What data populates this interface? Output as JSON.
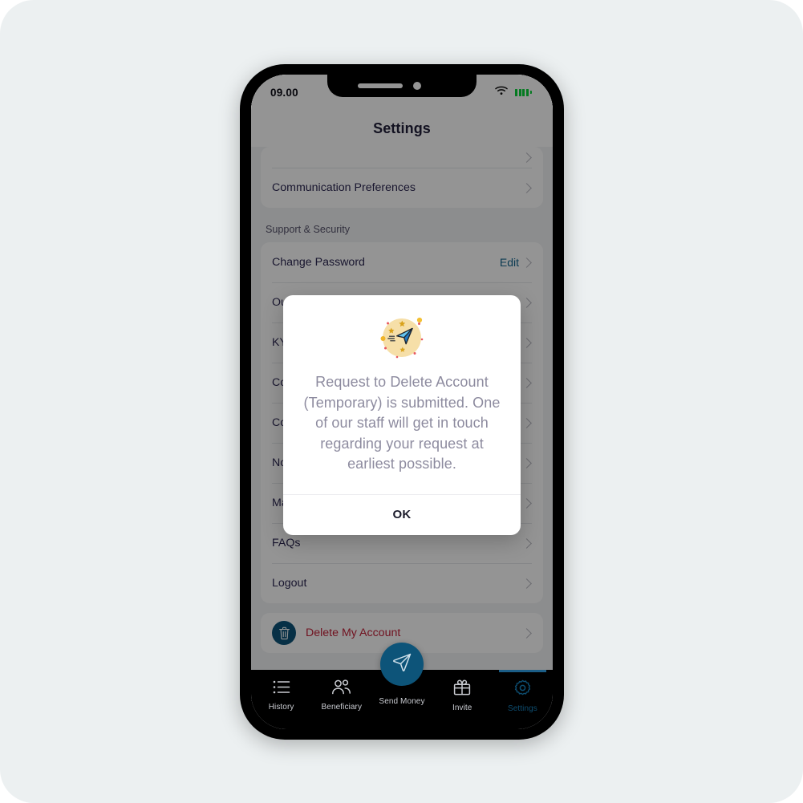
{
  "status_bar": {
    "time": "09.00",
    "wifi_icon": "wifi-icon",
    "battery_icon": "battery-icon"
  },
  "header": {
    "title": "Settings"
  },
  "settings": {
    "top_card_rows": [
      {
        "label": "Communication Preferences",
        "chevron": "chevron-right-icon"
      }
    ],
    "section_title": "Support & Security",
    "support_rows": [
      {
        "label": "Change Password",
        "action": "Edit",
        "chevron": "chevron-right-icon"
      },
      {
        "label": "Our",
        "chevron": "chevron-right-icon"
      },
      {
        "label": "KYC",
        "chevron": "chevron-right-icon"
      },
      {
        "label": "Con",
        "chevron": "chevron-right-icon"
      },
      {
        "label": "Con",
        "chevron": "chevron-right-icon"
      },
      {
        "label": "Not",
        "chevron": "chevron-right-icon"
      },
      {
        "label": "Mar",
        "chevron": "chevron-right-icon"
      },
      {
        "label": "FAQs",
        "chevron": "chevron-right-icon"
      },
      {
        "label": "Logout",
        "chevron": "chevron-right-icon"
      }
    ],
    "delete_row": {
      "label": "Delete My Account",
      "icon": "trash-icon",
      "chevron": "chevron-right-icon",
      "color": "#c32139",
      "icon_bg": "#0d5479"
    }
  },
  "modal": {
    "illustration": "paper-plane-illustration",
    "message": "Request to Delete Account (Temporary) is submitted. One of our staff will get in touch regarding your request at earliest possible.",
    "ok_label": "OK"
  },
  "bottom_nav": {
    "items": [
      {
        "label": "History",
        "icon": "list-icon",
        "active": false
      },
      {
        "label": "Beneficiary",
        "icon": "people-icon",
        "active": false
      },
      {
        "label": "Send Money",
        "icon": "send-plane-icon",
        "active": false
      },
      {
        "label": "Invite",
        "icon": "gift-icon",
        "active": false
      },
      {
        "label": "Settings",
        "icon": "gear-icon",
        "active": true
      }
    ],
    "active_color": "#0d4d70",
    "fab_color": "#0d5479"
  },
  "theme": {
    "page_bg": "#ffffff",
    "panel_bg": "#ecf0f1",
    "accent": "#0d5479",
    "danger": "#c32139",
    "text_primary": "#2b2752",
    "muted_text": "#8d8b9f"
  }
}
